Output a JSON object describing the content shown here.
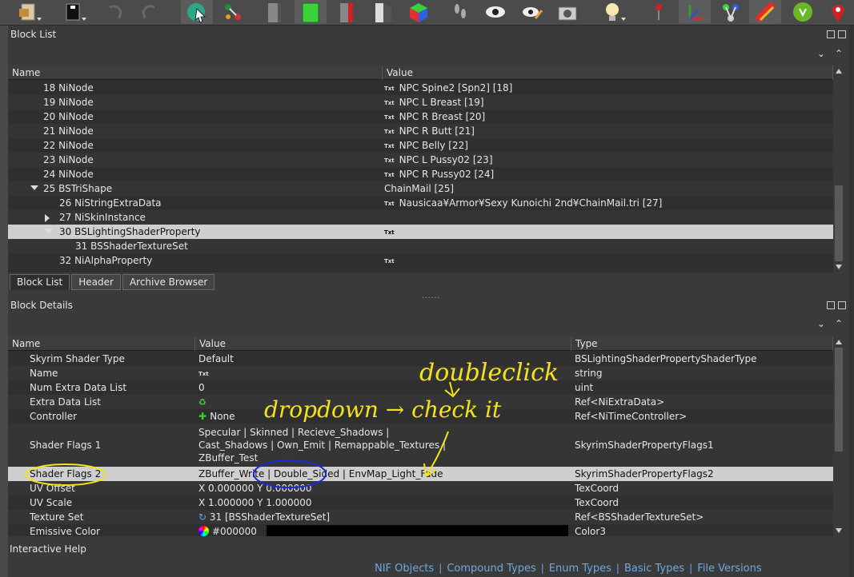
{
  "block_list": {
    "title": "Block List",
    "columns": [
      "Name",
      "Value"
    ],
    "rows": [
      {
        "name": "18 NiNode",
        "value": "NPC Spine2 [Spn2] [18]",
        "txt": true
      },
      {
        "name": "19 NiNode",
        "value": "NPC L Breast [19]",
        "txt": true
      },
      {
        "name": "20 NiNode",
        "value": "NPC R Breast [20]",
        "txt": true
      },
      {
        "name": "21 NiNode",
        "value": "NPC R Butt [21]",
        "txt": true
      },
      {
        "name": "22 NiNode",
        "value": "NPC Belly [22]",
        "txt": true
      },
      {
        "name": "23 NiNode",
        "value": "NPC L Pussy02 [23]",
        "txt": true
      },
      {
        "name": "24 NiNode",
        "value": "NPC R Pussy02 [24]",
        "txt": true
      },
      {
        "name": "25 BSTriShape",
        "value": "ChainMail [25]",
        "txt": false
      },
      {
        "name": "26 NiStringExtraData",
        "value": "Nausicaa¥Armor¥Sexy Kunoichi 2nd¥ChainMail.tri [27]",
        "txt": true
      },
      {
        "name": "27 NiSkinInstance",
        "value": "",
        "txt": false
      },
      {
        "name": "30 BSLightingShaderProperty",
        "value": "",
        "txt": true
      },
      {
        "name": "31 BSShaderTextureSet",
        "value": "",
        "txt": false
      },
      {
        "name": "32 NiAlphaProperty",
        "value": "",
        "txt": true
      }
    ]
  },
  "tabs": [
    "Block List",
    "Header",
    "Archive Browser"
  ],
  "block_details": {
    "title": "Block Details",
    "columns": [
      "Name",
      "Value",
      "Type"
    ],
    "rows": [
      {
        "name": "Skyrim Shader Type",
        "value": "Default",
        "type": "BSLightingShaderPropertyShaderType"
      },
      {
        "name": "Name",
        "value": "",
        "type": "string"
      },
      {
        "name": "Num Extra Data List",
        "value": "0",
        "type": "uint"
      },
      {
        "name": "Extra Data List",
        "value": "",
        "type": "Ref<NiExtraData>"
      },
      {
        "name": "Controller",
        "value": "None",
        "type": "Ref<NiTimeController>"
      },
      {
        "name": "Shader Flags 1",
        "value_lines": [
          "Specular | Skinned | Recieve_Shadows |",
          "Cast_Shadows | Own_Emit | Remappable_Textures |",
          "ZBuffer_Test"
        ],
        "type": "SkyrimShaderPropertyFlags1"
      },
      {
        "name": "Shader Flags 2",
        "value": "ZBuffer_Write | Double_Sided | EnvMap_Light_Fade",
        "type": "SkyrimShaderPropertyFlags2"
      },
      {
        "name": "UV Offset",
        "value": "X 0.000000 Y 0.000000",
        "type": "TexCoord"
      },
      {
        "name": "UV Scale",
        "value": "X 1.000000 Y 1.000000",
        "type": "TexCoord"
      },
      {
        "name": "Texture Set",
        "value": "31 [BSShaderTextureSet]",
        "type": "Ref<BSShaderTextureSet>"
      },
      {
        "name": "Emissive Color",
        "value": "#000000",
        "type": "Color3"
      }
    ]
  },
  "txt_badge": "Txt",
  "interactive_help": "Interactive Help",
  "bottom_links": [
    "NIF Objects",
    "Compound Types",
    "Enum Types",
    "Basic Types",
    "File Versions"
  ],
  "annotations": {
    "double_click": "doubleclick",
    "dropdown_check": "dropdown → check it"
  },
  "colors": {
    "annotation_yellow": "#f5e31a",
    "annotation_blue": "#1a2bd8",
    "link_blue": "#6fa8dc",
    "selected_row": "#cfcfcf"
  },
  "toolbar_icons": [
    "document-icon",
    "load-icon",
    "undo-icon",
    "redo-icon",
    "select-tool-icon",
    "transform-icon",
    "gray-block-icon",
    "green-block-icon",
    "red-block-icon",
    "split-block-icon",
    "color-cube-icon",
    "footprints-icon",
    "eye-icon",
    "eye-edit-icon",
    "camera-icon",
    "lightbulb-icon",
    "point-icon",
    "axes-icon",
    "nodes-icon",
    "texture-icon",
    "compass-icon",
    "map-pin-icon"
  ]
}
